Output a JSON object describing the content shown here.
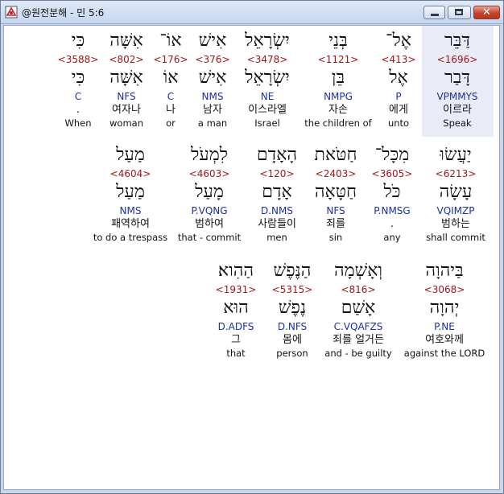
{
  "window": {
    "title": "@원전분해 - 민 5:6"
  },
  "rows": [
    {
      "words": [
        {
          "heb": "דַּבֵּר",
          "strong": "<1696>",
          "lemma": "דָּבַר",
          "parse": "VPMMYS",
          "kor": "이르라",
          "eng": "Speak"
        },
        {
          "heb": "אֶל־",
          "strong": "<413>",
          "lemma": "אֶל",
          "parse": "P",
          "kor": "에게",
          "eng": "unto"
        },
        {
          "heb": "בְּנֵי",
          "strong": "<1121>",
          "lemma": "בֵּן",
          "parse": "NMPG",
          "kor": "자손",
          "eng": "the children of"
        },
        {
          "heb": "יִשְׂרָאֵל",
          "strong": "<3478>",
          "lemma": "יִשְׂרָאֵל",
          "parse": "NE",
          "kor": "이스라엘",
          "eng": "Israel"
        },
        {
          "heb": "אִישׁ",
          "strong": "<376>",
          "lemma": "אִישׁ",
          "parse": "NMS",
          "kor": "남자",
          "eng": "a man"
        },
        {
          "heb": "אוֹ־",
          "strong": "<176>",
          "lemma": "אוֹ",
          "parse": "C",
          "kor": "나",
          "eng": "or"
        },
        {
          "heb": "אִשָּׁה",
          "strong": "<802>",
          "lemma": "אִשָּׁה",
          "parse": "NFS",
          "kor": "여자나",
          "eng": "woman"
        },
        {
          "heb": "כִּי",
          "strong": "<3588>",
          "lemma": "כִּי",
          "parse": "C",
          "kor": ".",
          "eng": "When"
        }
      ]
    },
    {
      "words": [
        {
          "heb": "יַעֲשׂוּ",
          "strong": "<6213>",
          "lemma": "עָשָׂה",
          "parse": "VQIMZP",
          "kor": "범하는",
          "eng": "shall commit"
        },
        {
          "heb": "מִכָּל־",
          "strong": "<3605>",
          "lemma": "כֹּל",
          "parse": "P.NMSG",
          "kor": ".",
          "eng": "any"
        },
        {
          "heb": "חַטֹּאת",
          "strong": "<2403>",
          "lemma": "חַטָּאָה",
          "parse": "NFS",
          "kor": "죄를",
          "eng": "sin"
        },
        {
          "heb": "הָאָדָם",
          "strong": "<120>",
          "lemma": "אָדָם",
          "parse": "D.NMS",
          "kor": "사람들이",
          "eng": "men"
        },
        {
          "heb": "לִמְעֹל",
          "strong": "<4603>",
          "lemma": "מָעַל",
          "parse": "P.VQNG",
          "kor": "범하여",
          "eng": "that - commit"
        },
        {
          "heb": "מַעַל",
          "strong": "<4604>",
          "lemma": "מַעַל",
          "parse": "NMS",
          "kor": "패역하여",
          "eng": "to do a trespass"
        }
      ]
    },
    {
      "words": [
        {
          "heb": "בַּיהוָה",
          "strong": "<3068>",
          "lemma": "יְהוָה",
          "parse": "P.NE",
          "kor": "여호와께",
          "eng": "against the LORD"
        },
        {
          "heb": "וְאָשְׁמָה",
          "strong": "<816>",
          "lemma": "אָשַׁם",
          "parse": "C.VQAFZS",
          "kor": "죄를 얼거든",
          "eng": "and - be guilty"
        },
        {
          "heb": "הַנֶּפֶשׁ",
          "strong": "<5315>",
          "lemma": "נֶפֶשׁ",
          "parse": "D.NFS",
          "kor": "몸에",
          "eng": "person"
        },
        {
          "heb": "הַהִוא׃",
          "strong": "<1931>",
          "lemma": "הוּא",
          "parse": "D.ADFS",
          "kor": "그",
          "eng": "that"
        }
      ]
    }
  ]
}
